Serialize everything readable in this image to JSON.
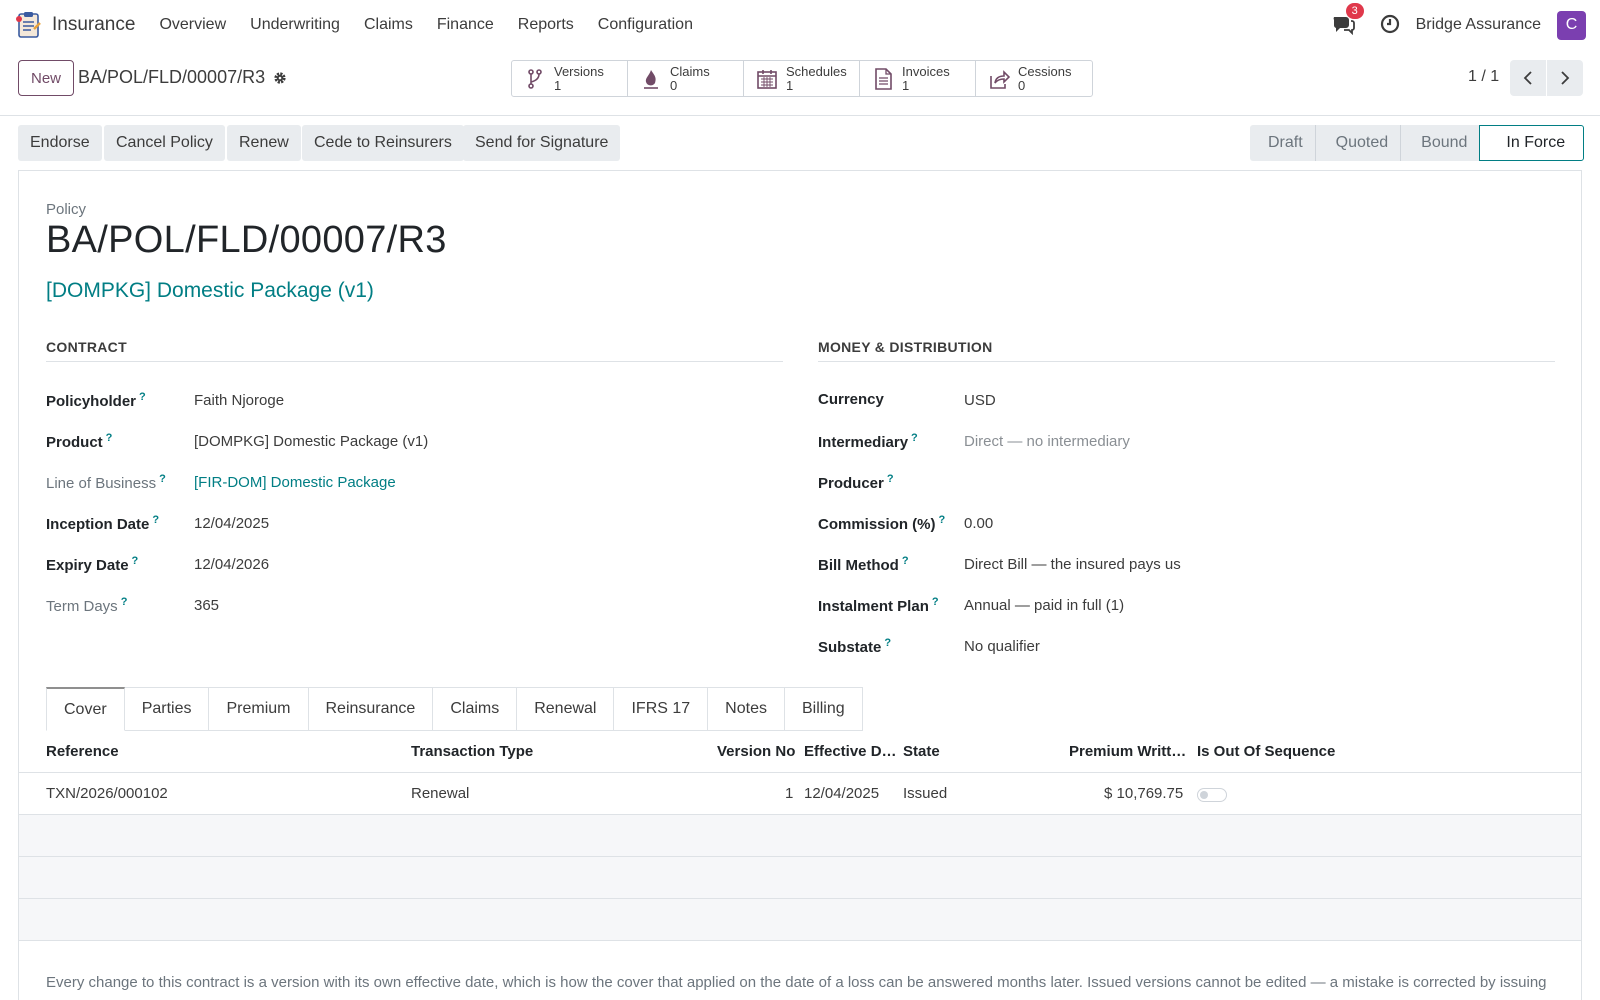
{
  "app": {
    "name": "Insurance"
  },
  "menu": [
    "Overview",
    "Underwriting",
    "Claims",
    "Finance",
    "Reports",
    "Configuration"
  ],
  "navbar": {
    "message_count": "3",
    "company": "Bridge Assurance",
    "avatar_letter": "C"
  },
  "control": {
    "new_label": "New",
    "record_name": "BA/POL/FLD/00007/R3",
    "pager": "1 / 1"
  },
  "smart_buttons": [
    {
      "label": "Versions",
      "count": "1",
      "icon": "branch-icon"
    },
    {
      "label": "Claims",
      "count": "0",
      "icon": "flame-icon"
    },
    {
      "label": "Schedules",
      "count": "1",
      "icon": "calendar-icon"
    },
    {
      "label": "Invoices",
      "count": "1",
      "icon": "document-icon"
    },
    {
      "label": "Cessions",
      "count": "0",
      "icon": "share-icon"
    }
  ],
  "actions": [
    "Endorse",
    "Cancel Policy",
    "Renew",
    "Cede to Reinsurers",
    "Send for Signature"
  ],
  "stages": [
    "Draft",
    "Quoted",
    "Bound",
    "In Force"
  ],
  "active_stage": "In Force",
  "sheet": {
    "label": "Policy",
    "title": "BA/POL/FLD/00007/R3",
    "product_link": "[DOMPKG] Domestic Package (v1)"
  },
  "contract": {
    "title": "CONTRACT",
    "fields": [
      {
        "label": "Policyholder",
        "value": "Faith Njoroge"
      },
      {
        "label": "Product",
        "value": "[DOMPKG] Domestic Package (v1)"
      },
      {
        "label": "Line of Business",
        "value": "[FIR-DOM] Domestic Package"
      },
      {
        "label": "Inception Date",
        "value": "12/04/2025"
      },
      {
        "label": "Expiry Date",
        "value": "12/04/2026"
      },
      {
        "label": "Term Days",
        "value": "365"
      }
    ]
  },
  "money": {
    "title": "MONEY & DISTRIBUTION",
    "fields": [
      {
        "label": "Currency",
        "value": "USD"
      },
      {
        "label": "Intermediary",
        "value": "Direct — no intermediary"
      },
      {
        "label": "Producer",
        "value": ""
      },
      {
        "label": "Commission (%)",
        "value": "0.00"
      },
      {
        "label": "Bill Method",
        "value": "Direct Bill — the insured pays us"
      },
      {
        "label": "Instalment Plan",
        "value": "Annual — paid in full (1)"
      },
      {
        "label": "Substate",
        "value": "No qualifier"
      }
    ]
  },
  "tabs": [
    "Cover",
    "Parties",
    "Premium",
    "Reinsurance",
    "Claims",
    "Renewal",
    "IFRS 17",
    "Notes",
    "Billing"
  ],
  "active_tab": "Cover",
  "table": {
    "columns": [
      "Reference",
      "Transaction Type",
      "Version No",
      "Effective D…",
      "State",
      "Premium Writt…",
      "Is Out Of Sequence"
    ],
    "rows": [
      {
        "reference": "TXN/2026/000102",
        "type": "Renewal",
        "version": "1",
        "effective": "12/04/2025",
        "state": "Issued",
        "premium": "$ 10,769.75",
        "out_of_sequence": false
      }
    ]
  },
  "footnote": "Every change to this contract is a version with its own effective date, which is how the cover that applied on the date of a loss can be answered months later. Issued versions cannot be edited — a mistake is corrected by issuing another.",
  "colors": {
    "accent": "#017e84",
    "brand": "#714b67",
    "avatar": "#7b3fb0",
    "badge": "#e0384b"
  }
}
